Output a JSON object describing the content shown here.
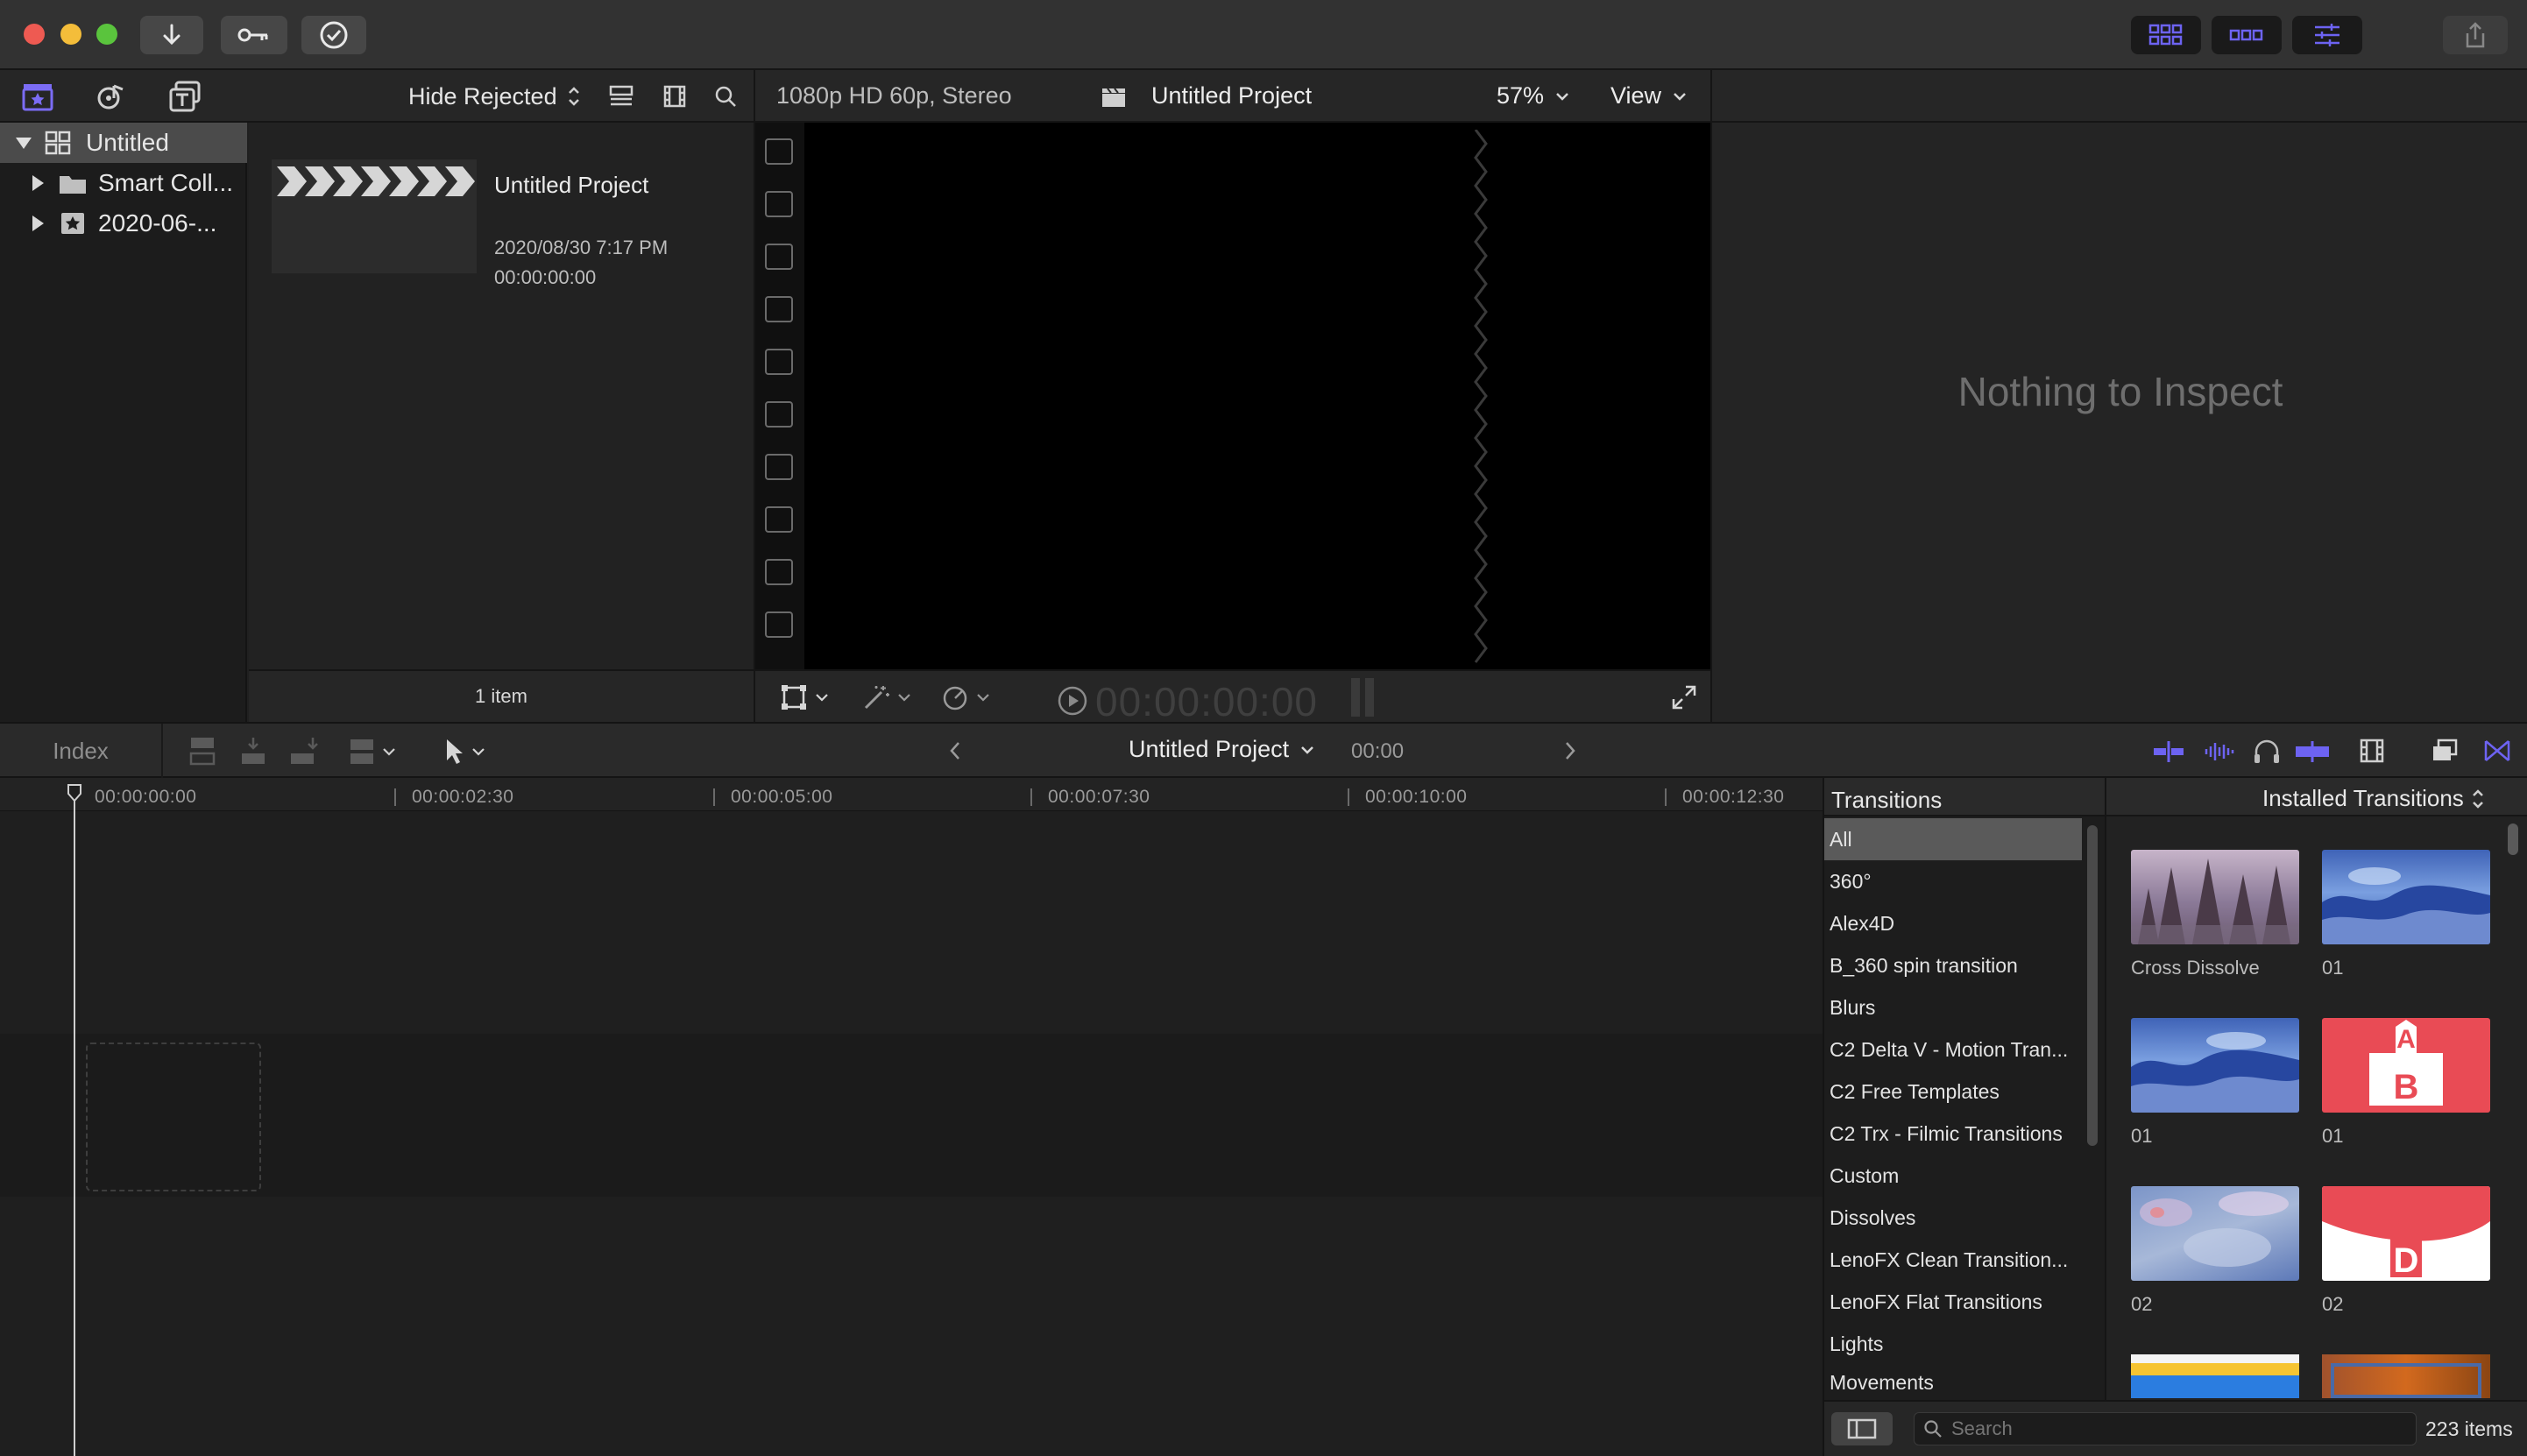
{
  "toolbar": {
    "buttons": [
      "import-media",
      "keywords",
      "background-tasks"
    ],
    "right_buttons": [
      "show-browser",
      "show-timeline",
      "show-inspector",
      "share"
    ]
  },
  "library_toolbar": {
    "filter_label": "Hide Rejected"
  },
  "library": {
    "root": "Untitled",
    "items": [
      "Smart Coll...",
      "2020-06-..."
    ]
  },
  "browser": {
    "clip_title": "Untitled Project",
    "clip_date": "2020/08/30 7:17 PM",
    "clip_duration": "00:00:00:00",
    "item_count": "1 item"
  },
  "viewer": {
    "format": "1080p HD 60p, Stereo",
    "project": "Untitled Project",
    "zoom": "57%",
    "view_label": "View",
    "timecode": "00:00:00:00"
  },
  "inspector": {
    "empty_text": "Nothing to Inspect"
  },
  "timeline_bar": {
    "index_label": "Index",
    "project": "Untitled Project",
    "duration": "00:00"
  },
  "ruler": [
    "00:00:00:00",
    "00:00:02:30",
    "00:00:05:00",
    "00:00:07:30",
    "00:00:10:00",
    "00:00:12:30"
  ],
  "transitions": {
    "header": "Transitions",
    "installed": "Installed Transitions",
    "categories": [
      "All",
      "360°",
      "Alex4D",
      "B_360 spin transition",
      "Blurs",
      "C2 Delta V - Motion Tran...",
      "C2 Free Templates",
      "C2 Trx - Filmic Transitions",
      "Custom",
      "Dissolves",
      "LenoFX Clean Transition...",
      "LenoFX Flat Transitions",
      "Lights",
      "Movements"
    ],
    "thumbnails": [
      {
        "caption": "Cross Dissolve",
        "kind": "forest"
      },
      {
        "caption": "01",
        "kind": "blue"
      },
      {
        "caption": "01",
        "kind": "blue"
      },
      {
        "caption": "01",
        "kind": "red-ab"
      },
      {
        "caption": "02",
        "kind": "sky"
      },
      {
        "caption": "02",
        "kind": "white-ab"
      }
    ],
    "search_placeholder": "Search",
    "count": "223 items"
  },
  "colors": {
    "accent": "#7b6cf5",
    "background": "#202020",
    "viewer": "#000000"
  }
}
